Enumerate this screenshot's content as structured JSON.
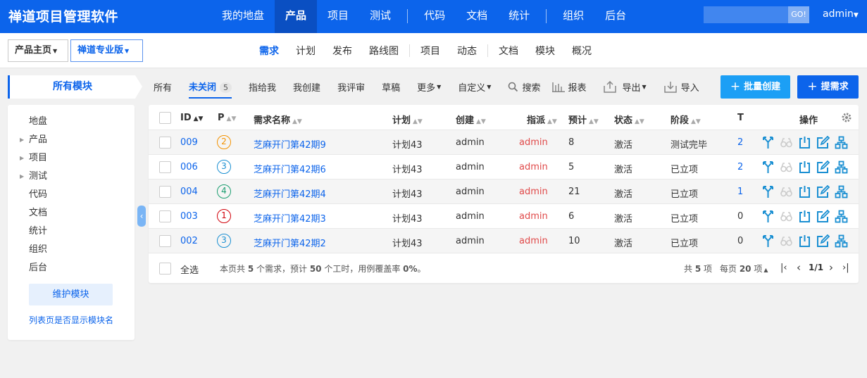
{
  "header": {
    "brand": "禅道项目管理软件",
    "nav": [
      "我的地盘",
      "产品",
      "项目",
      "测试",
      "|",
      "代码",
      "文档",
      "统计",
      "|",
      "组织",
      "后台"
    ],
    "active": "产品",
    "search_go": "GO!",
    "user": "admin"
  },
  "subbar": {
    "product_home": "产品主页",
    "product_name": "禅道专业版",
    "nav": [
      "需求",
      "计划",
      "发布",
      "路线图",
      "|",
      "项目",
      "动态",
      "|",
      "文档",
      "模块",
      "概况"
    ],
    "active": "需求"
  },
  "sidebar": {
    "title": "所有模块",
    "items": [
      {
        "label": "地盘",
        "expandable": false
      },
      {
        "label": "产品",
        "expandable": true
      },
      {
        "label": "项目",
        "expandable": true
      },
      {
        "label": "测试",
        "expandable": true
      },
      {
        "label": "代码",
        "expandable": false
      },
      {
        "label": "文档",
        "expandable": false
      },
      {
        "label": "统计",
        "expandable": false
      },
      {
        "label": "组织",
        "expandable": false
      },
      {
        "label": "后台",
        "expandable": false
      }
    ],
    "maintain_button": "维护模块",
    "module_name_link": "列表页是否显示模块名"
  },
  "filters": {
    "all": "所有",
    "unclosed": "未关闭",
    "unclosed_count": "5",
    "assigned": "指给我",
    "created": "我创建",
    "reviewed": "我评审",
    "draft": "草稿",
    "more": "更多",
    "custom": "自定义",
    "search": "搜索",
    "report": "报表",
    "export": "导出",
    "import": "导入"
  },
  "buttons": {
    "batch_create": "批量创建",
    "create": "提需求"
  },
  "table": {
    "headers": {
      "id": "ID",
      "pri": "P",
      "title": "需求名称",
      "plan": "计划",
      "opened_by": "创建",
      "assigned_to": "指派",
      "estimate": "预计",
      "status": "状态",
      "stage": "阶段",
      "tasks": "T",
      "actions": "操作"
    },
    "rows": [
      {
        "id": "009",
        "pri": "2",
        "title": "芝麻开门第42期9",
        "plan": "计划43",
        "opened_by": "admin",
        "assigned_to": "admin",
        "estimate": "8",
        "status": "激活",
        "stage": "测试完毕",
        "tasks": "2"
      },
      {
        "id": "006",
        "pri": "3",
        "title": "芝麻开门第42期6",
        "plan": "计划43",
        "opened_by": "admin",
        "assigned_to": "admin",
        "estimate": "5",
        "status": "激活",
        "stage": "已立项",
        "tasks": "2"
      },
      {
        "id": "004",
        "pri": "4",
        "title": "芝麻开门第42期4",
        "plan": "计划43",
        "opened_by": "admin",
        "assigned_to": "admin",
        "estimate": "21",
        "status": "激活",
        "stage": "已立项",
        "tasks": "1"
      },
      {
        "id": "003",
        "pri": "1",
        "title": "芝麻开门第42期3",
        "plan": "计划43",
        "opened_by": "admin",
        "assigned_to": "admin",
        "estimate": "6",
        "status": "激活",
        "stage": "已立项",
        "tasks": "0"
      },
      {
        "id": "002",
        "pri": "3",
        "title": "芝麻开门第42期2",
        "plan": "计划43",
        "opened_by": "admin",
        "assigned_to": "admin",
        "estimate": "10",
        "status": "激活",
        "stage": "已立项",
        "tasks": "0"
      }
    ],
    "pri_colors": {
      "1": "#d1000a",
      "2": "#f39200",
      "3": "#1a8fd2",
      "4": "#1b9e70"
    },
    "action_icons": [
      "change-icon",
      "review-icon",
      "close-icon",
      "edit-icon",
      "create-case-icon"
    ]
  },
  "footer": {
    "select_all": "全选",
    "summary_pre": "本页共 ",
    "summary_count": "5",
    "summary_mid": " 个需求，预计 ",
    "summary_hours": "50",
    "summary_post": " 个工时，用例覆盖率 ",
    "summary_rate": "0%",
    "summary_end": "。",
    "total_pre": "共 ",
    "total": "5",
    "total_post": " 项",
    "per_page_pre": "每页 ",
    "per_page": "20",
    "per_page_post": " 项",
    "page": "1/1"
  },
  "colors": {
    "primary": "#0c64eb",
    "header_active": "#0a4fc2",
    "batch_button": "#1c9ff5"
  }
}
